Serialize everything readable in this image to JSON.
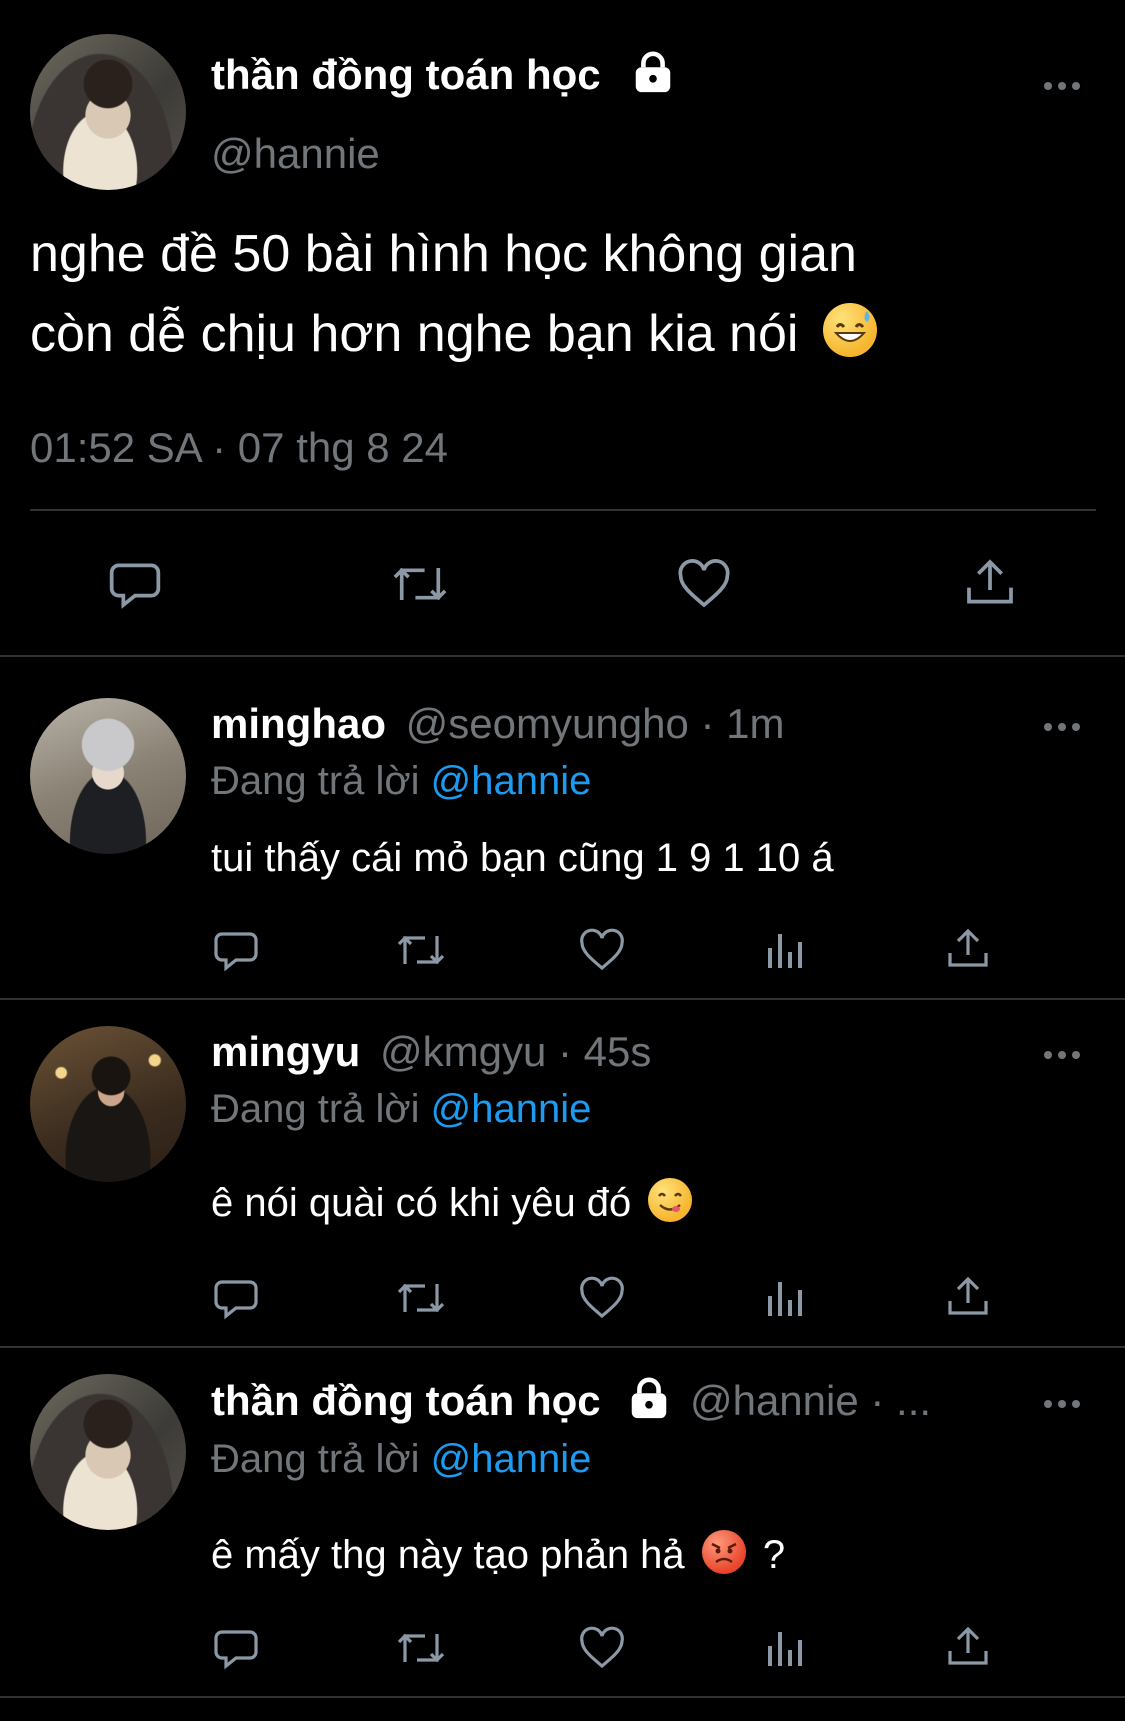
{
  "main_tweet": {
    "display_name": "thần đồng toán học",
    "handle": "@hannie",
    "text_line1": "nghe đề 50 bài hình học không gian",
    "text_line2": "còn dễ chịu hơn nghe bạn kia nói",
    "timestamp": "01:52 SA · 07 thg 8 24",
    "emoji": "grinning-sweat"
  },
  "replies": [
    {
      "display_name": "minghao",
      "handle": "@seomyungho",
      "time": "· 1m",
      "replying_label": "Đang trả lời",
      "replying_to": "@hannie",
      "text": "tui thấy cái mỏ bạn cũng 1 9 1 10 á"
    },
    {
      "display_name": "mingyu",
      "handle": "@kmgyu",
      "time": "· 45s",
      "replying_label": "Đang trả lời",
      "replying_to": "@hannie",
      "text": "ê nói quài có khi yêu đó",
      "emoji": "yum-face"
    },
    {
      "display_name": "thần đồng toán học",
      "handle": "@hannie",
      "time": "· ...",
      "replying_label": "Đang trả lời",
      "replying_to": "@hannie",
      "text": "ê mấy thg này tạo phản hả",
      "text_suffix": "?",
      "emoji": "angry-face"
    }
  ],
  "icons": [
    "reply-icon",
    "retweet-icon",
    "like-icon",
    "views-icon",
    "share-icon",
    "lock-icon",
    "more-icon"
  ],
  "colors": {
    "background": "#000000",
    "muted": "#71767b",
    "link": "#1d9bf0",
    "divider": "#2f3336"
  }
}
